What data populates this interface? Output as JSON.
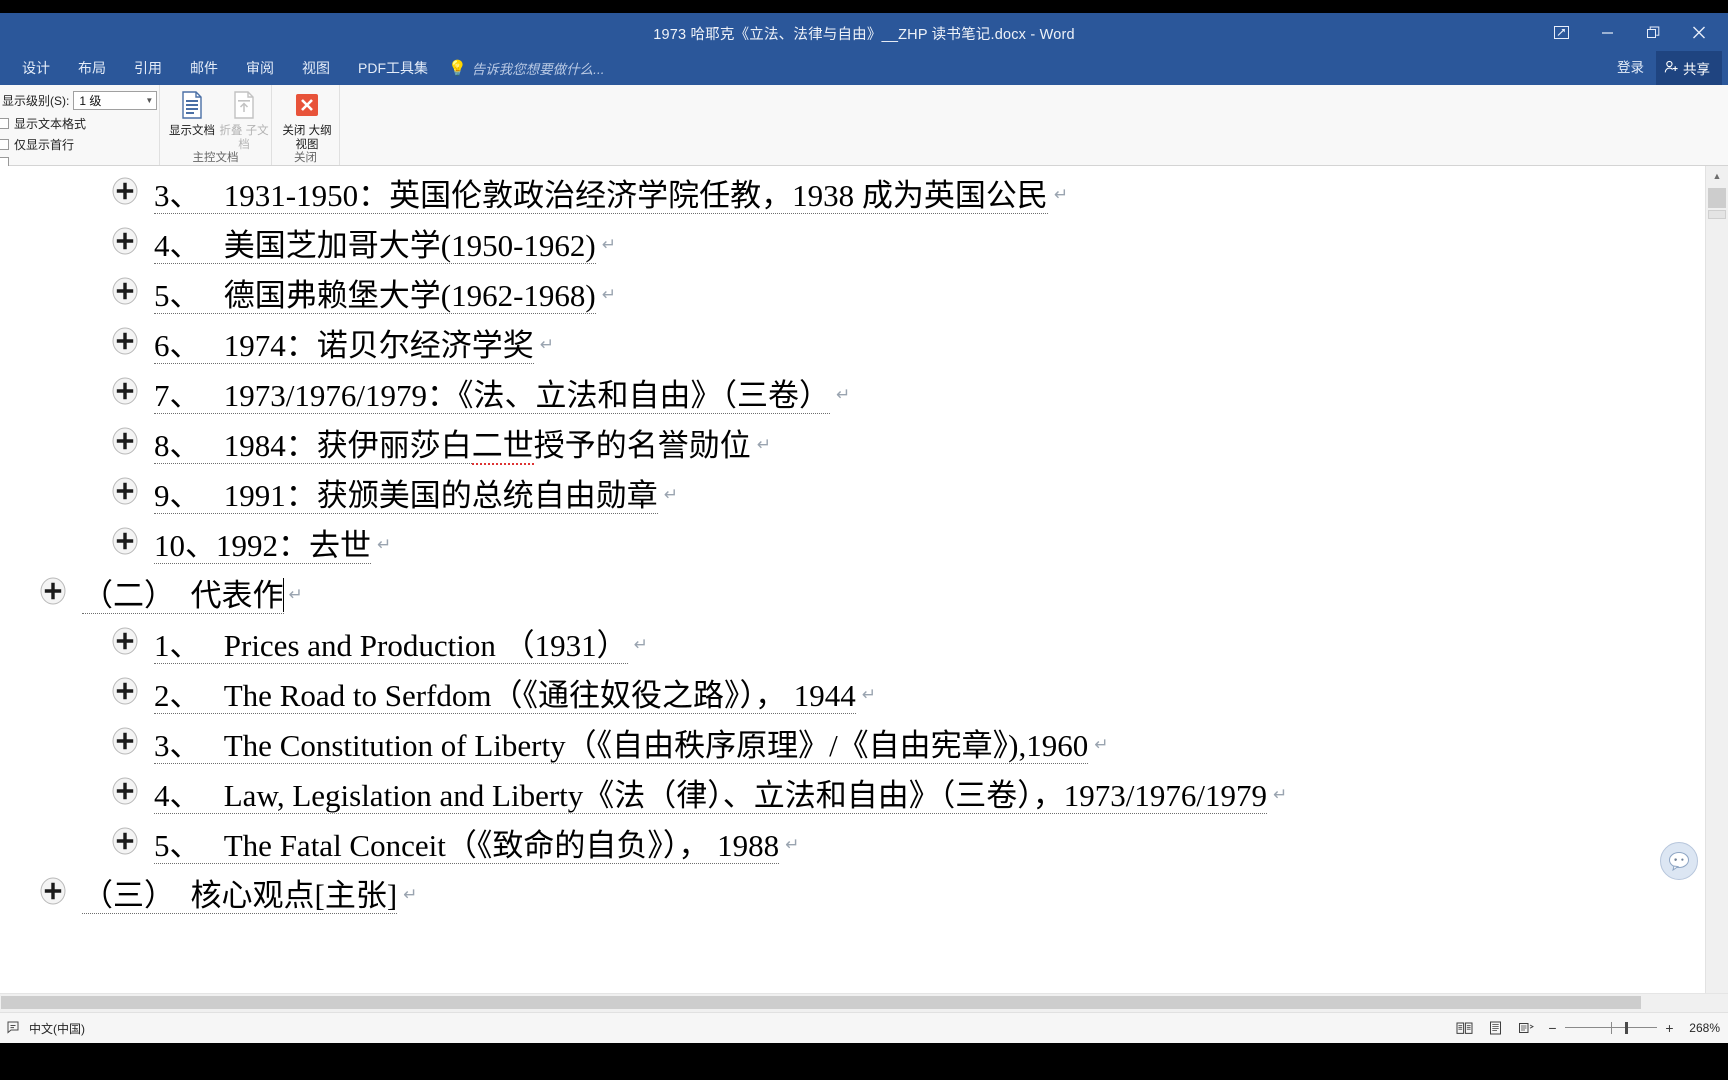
{
  "window": {
    "title": "1973 哈耶克《立法、法律与自由》__ZHP 读书笔记.docx - Word",
    "accent_color": "#2b579a",
    "buttons": {
      "ribbon_display_options": "功能区显示选项",
      "minimize": "最小化",
      "restore": "向下还原",
      "close": "关闭"
    }
  },
  "tabs": [
    {
      "label": "设计"
    },
    {
      "label": "布局"
    },
    {
      "label": "引用"
    },
    {
      "label": "邮件"
    },
    {
      "label": "审阅"
    },
    {
      "label": "视图"
    },
    {
      "label": "PDF工具集"
    }
  ],
  "tell_me": {
    "label": "告诉我您想要做什么..."
  },
  "account": {
    "sign_in": "登录",
    "share": "共享"
  },
  "ribbon": {
    "groups": [
      {
        "name": "outline_tools",
        "label": ""
      },
      {
        "name": "master_document",
        "label": "主控文档"
      },
      {
        "name": "close",
        "label": "关闭"
      }
    ],
    "outline_tools": {
      "show_level_label": "显示级别(S):",
      "show_level_value": "1 级",
      "show_text_formatting": "显示文本格式",
      "show_first_line_only": "仅显示首行"
    },
    "master_document": {
      "show_document": "显示文档",
      "collapse_subdocuments_line1": "折叠",
      "collapse_subdocuments_line2": "子文档"
    },
    "close_group": {
      "close_outline_view_line1": "关闭",
      "close_outline_view_line2": "大纲视图"
    }
  },
  "document": {
    "lines": [
      {
        "level": 1,
        "bullet": "expand-plus-icon",
        "segments": [
          {
            "text": "3、   1931-1950：英国伦敦政治经济学院任教，1938 成为英国公民",
            "style": "underline-dotted"
          }
        ],
        "pilcrow": true
      },
      {
        "level": 1,
        "bullet": "expand-plus-icon",
        "segments": [
          {
            "text": "4、   美国芝加哥大学(1950-1962)",
            "style": "underline-dotted"
          }
        ],
        "pilcrow": true
      },
      {
        "level": 1,
        "bullet": "expand-plus-icon",
        "segments": [
          {
            "text": "5、   德国弗赖堡大学(1962-1968)",
            "style": "underline-dotted"
          }
        ],
        "pilcrow": true
      },
      {
        "level": 1,
        "bullet": "expand-plus-icon",
        "segments": [
          {
            "text": "6、   1974：诺贝尔经济学奖",
            "style": "underline-dotted"
          }
        ],
        "pilcrow": true
      },
      {
        "level": 1,
        "bullet": "expand-plus-icon",
        "segments": [
          {
            "text": "7、   1973/1976/1979：《法、立法和自由》（三卷）",
            "style": "underline-dotted"
          }
        ],
        "pilcrow": true
      },
      {
        "level": 1,
        "bullet": "expand-plus-icon",
        "segments": [
          {
            "text": "8、   1984：获伊丽莎白",
            "style": "underline-dotted"
          },
          {
            "text": "二世",
            "style": "spelling-error"
          },
          {
            "text": "授予的名誉勋位",
            "style": "plain"
          }
        ],
        "pilcrow": true
      },
      {
        "level": 1,
        "bullet": "expand-plus-icon",
        "segments": [
          {
            "text": "9、   1991：获颁美国的总统自由勋章",
            "style": "underline-dotted"
          }
        ],
        "pilcrow": true
      },
      {
        "level": 1,
        "bullet": "expand-plus-icon",
        "segments": [
          {
            "text": "10、1992：去世",
            "style": "underline-dotted"
          }
        ],
        "pilcrow": true
      },
      {
        "level": 0,
        "bullet": "expand-plus-icon",
        "segments": [
          {
            "text": "（二）　代表作",
            "style": "underline-dotted",
            "cursor_after": 8
          }
        ],
        "pilcrow": true
      },
      {
        "level": 1,
        "bullet": "expand-plus-icon",
        "segments": [
          {
            "text": "1、   Prices and Production （1931）",
            "style": "underline-dotted"
          }
        ],
        "pilcrow": true
      },
      {
        "level": 1,
        "bullet": "expand-plus-icon",
        "segments": [
          {
            "text": "2、   The Road to Serfdom（《通往奴役之路》）， 1944",
            "style": "underline-dotted"
          }
        ],
        "pilcrow": true
      },
      {
        "level": 1,
        "bullet": "expand-plus-icon",
        "segments": [
          {
            "text": "3、   The Constitution of Liberty（《自由秩序原理》/《自由宪章》),1960",
            "style": "underline-dotted"
          }
        ],
        "pilcrow": true
      },
      {
        "level": 1,
        "bullet": "expand-plus-icon",
        "segments": [
          {
            "text": "4、   Law, Legislation and Liberty《法（律）、立法和自由》（三卷），1973/1976/1979",
            "style": "underline-dotted"
          }
        ],
        "pilcrow": true
      },
      {
        "level": 1,
        "bullet": "expand-plus-icon",
        "segments": [
          {
            "text": "5、   The Fatal Conceit（《致命的自负》）， 1988",
            "style": "underline-dotted"
          }
        ],
        "pilcrow": true
      },
      {
        "level": 0,
        "bullet": "expand-plus-icon",
        "segments": [
          {
            "text": "（三）　核心观点[主张]",
            "style": "underline-dotted"
          }
        ],
        "pilcrow": true
      }
    ]
  },
  "status_bar": {
    "proofing_icon": "proofing-errors-icon",
    "language": "中文(中国)",
    "view_buttons": [
      {
        "name": "read-mode-icon"
      },
      {
        "name": "print-layout-icon"
      },
      {
        "name": "web-layout-icon"
      }
    ],
    "zoom": {
      "minus": "−",
      "plus": "+",
      "level": "268%"
    }
  }
}
